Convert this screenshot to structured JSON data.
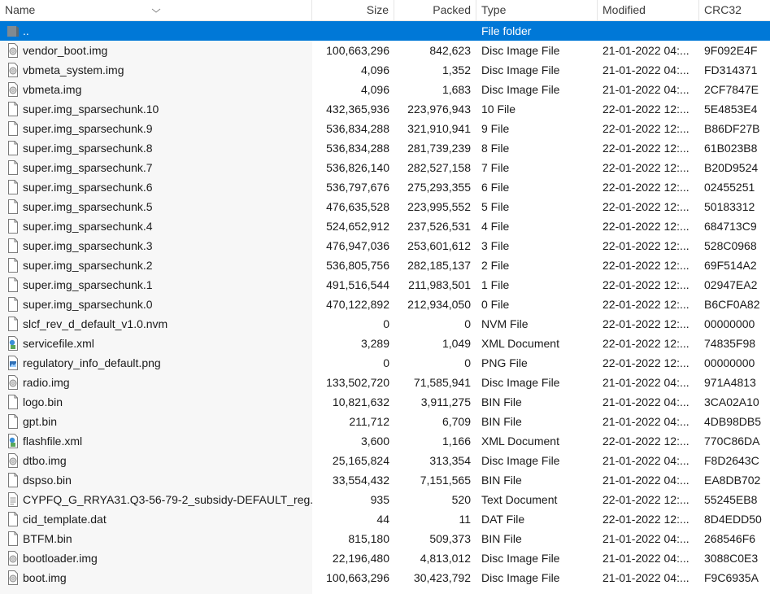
{
  "columns": {
    "name": "Name",
    "size": "Size",
    "packed": "Packed",
    "type": "Type",
    "modified": "Modified",
    "crc": "CRC32"
  },
  "rows": [
    {
      "name": "..",
      "size": "",
      "packed": "",
      "type": "File folder",
      "modified": "",
      "crc": "",
      "icon": "folder-icon",
      "selected": true
    },
    {
      "name": "vendor_boot.img",
      "size": "100,663,296",
      "packed": "842,623",
      "type": "Disc Image File",
      "modified": "21-01-2022 04:...",
      "crc": "9F092E4F",
      "icon": "disc-image-icon"
    },
    {
      "name": "vbmeta_system.img",
      "size": "4,096",
      "packed": "1,352",
      "type": "Disc Image File",
      "modified": "21-01-2022 04:...",
      "crc": "FD314371",
      "icon": "disc-image-icon"
    },
    {
      "name": "vbmeta.img",
      "size": "4,096",
      "packed": "1,683",
      "type": "Disc Image File",
      "modified": "21-01-2022 04:...",
      "crc": "2CF7847E",
      "icon": "disc-image-icon"
    },
    {
      "name": "super.img_sparsechunk.10",
      "size": "432,365,936",
      "packed": "223,976,943",
      "type": "10 File",
      "modified": "22-01-2022 12:...",
      "crc": "5E4853E4",
      "icon": "file-icon"
    },
    {
      "name": "super.img_sparsechunk.9",
      "size": "536,834,288",
      "packed": "321,910,941",
      "type": "9 File",
      "modified": "22-01-2022 12:...",
      "crc": "B86DF27B",
      "icon": "file-icon"
    },
    {
      "name": "super.img_sparsechunk.8",
      "size": "536,834,288",
      "packed": "281,739,239",
      "type": "8 File",
      "modified": "22-01-2022 12:...",
      "crc": "61B023B8",
      "icon": "file-icon"
    },
    {
      "name": "super.img_sparsechunk.7",
      "size": "536,826,140",
      "packed": "282,527,158",
      "type": "7 File",
      "modified": "22-01-2022 12:...",
      "crc": "B20D9524",
      "icon": "file-icon"
    },
    {
      "name": "super.img_sparsechunk.6",
      "size": "536,797,676",
      "packed": "275,293,355",
      "type": "6 File",
      "modified": "22-01-2022 12:...",
      "crc": "02455251",
      "icon": "file-icon"
    },
    {
      "name": "super.img_sparsechunk.5",
      "size": "476,635,528",
      "packed": "223,995,552",
      "type": "5 File",
      "modified": "22-01-2022 12:...",
      "crc": "50183312",
      "icon": "file-icon"
    },
    {
      "name": "super.img_sparsechunk.4",
      "size": "524,652,912",
      "packed": "237,526,531",
      "type": "4 File",
      "modified": "22-01-2022 12:...",
      "crc": "684713C9",
      "icon": "file-icon"
    },
    {
      "name": "super.img_sparsechunk.3",
      "size": "476,947,036",
      "packed": "253,601,612",
      "type": "3 File",
      "modified": "22-01-2022 12:...",
      "crc": "528C0968",
      "icon": "file-icon"
    },
    {
      "name": "super.img_sparsechunk.2",
      "size": "536,805,756",
      "packed": "282,185,137",
      "type": "2 File",
      "modified": "22-01-2022 12:...",
      "crc": "69F514A2",
      "icon": "file-icon"
    },
    {
      "name": "super.img_sparsechunk.1",
      "size": "491,516,544",
      "packed": "211,983,501",
      "type": "1 File",
      "modified": "22-01-2022 12:...",
      "crc": "02947EA2",
      "icon": "file-icon"
    },
    {
      "name": "super.img_sparsechunk.0",
      "size": "470,122,892",
      "packed": "212,934,050",
      "type": "0 File",
      "modified": "22-01-2022 12:...",
      "crc": "B6CF0A82",
      "icon": "file-icon"
    },
    {
      "name": "slcf_rev_d_default_v1.0.nvm",
      "size": "0",
      "packed": "0",
      "type": "NVM File",
      "modified": "22-01-2022 12:...",
      "crc": "00000000",
      "icon": "file-icon"
    },
    {
      "name": "servicefile.xml",
      "size": "3,289",
      "packed": "1,049",
      "type": "XML Document",
      "modified": "22-01-2022 12:...",
      "crc": "74835F98",
      "icon": "xml-file-icon"
    },
    {
      "name": "regulatory_info_default.png",
      "size": "0",
      "packed": "0",
      "type": "PNG File",
      "modified": "22-01-2022 12:...",
      "crc": "00000000",
      "icon": "image-file-icon"
    },
    {
      "name": "radio.img",
      "size": "133,502,720",
      "packed": "71,585,941",
      "type": "Disc Image File",
      "modified": "21-01-2022 04:...",
      "crc": "971A4813",
      "icon": "disc-image-icon"
    },
    {
      "name": "logo.bin",
      "size": "10,821,632",
      "packed": "3,911,275",
      "type": "BIN File",
      "modified": "21-01-2022 04:...",
      "crc": "3CA02A10",
      "icon": "file-icon"
    },
    {
      "name": "gpt.bin",
      "size": "211,712",
      "packed": "6,709",
      "type": "BIN File",
      "modified": "21-01-2022 04:...",
      "crc": "4DB98DB5",
      "icon": "file-icon"
    },
    {
      "name": "flashfile.xml",
      "size": "3,600",
      "packed": "1,166",
      "type": "XML Document",
      "modified": "22-01-2022 12:...",
      "crc": "770C86DA",
      "icon": "xml-file-icon"
    },
    {
      "name": "dtbo.img",
      "size": "25,165,824",
      "packed": "313,354",
      "type": "Disc Image File",
      "modified": "21-01-2022 04:...",
      "crc": "F8D2643C",
      "icon": "disc-image-icon"
    },
    {
      "name": "dspso.bin",
      "size": "33,554,432",
      "packed": "7,151,565",
      "type": "BIN File",
      "modified": "21-01-2022 04:...",
      "crc": "EA8DB702",
      "icon": "file-icon"
    },
    {
      "name": "CYPFQ_G_RRYA31.Q3-56-79-2_subsidy-DEFAULT_reg...",
      "size": "935",
      "packed": "520",
      "type": "Text Document",
      "modified": "22-01-2022 12:...",
      "crc": "55245EB8",
      "icon": "text-file-icon"
    },
    {
      "name": "cid_template.dat",
      "size": "44",
      "packed": "11",
      "type": "DAT File",
      "modified": "22-01-2022 12:...",
      "crc": "8D4EDD50",
      "icon": "file-icon"
    },
    {
      "name": "BTFM.bin",
      "size": "815,180",
      "packed": "509,373",
      "type": "BIN File",
      "modified": "21-01-2022 04:...",
      "crc": "268546F6",
      "icon": "file-icon"
    },
    {
      "name": "bootloader.img",
      "size": "22,196,480",
      "packed": "4,813,012",
      "type": "Disc Image File",
      "modified": "21-01-2022 04:...",
      "crc": "3088C0E3",
      "icon": "disc-image-icon"
    },
    {
      "name": "boot.img",
      "size": "100,663,296",
      "packed": "30,423,792",
      "type": "Disc Image File",
      "modified": "21-01-2022 04:...",
      "crc": "F9C6935A",
      "icon": "disc-image-icon"
    }
  ]
}
